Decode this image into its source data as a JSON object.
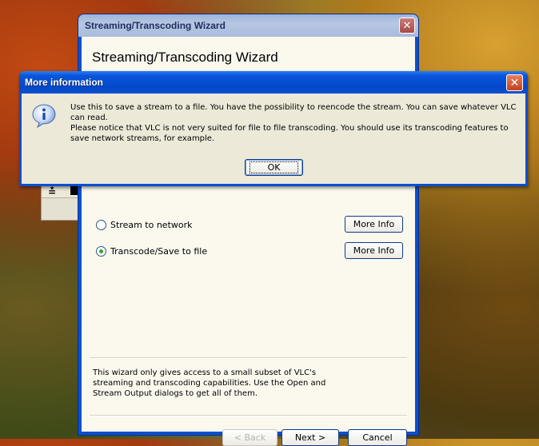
{
  "wizard": {
    "title": "Streaming/Transcoding Wizard",
    "heading": "Streaming/Transcoding Wizard",
    "close_glyph": "✕",
    "options": [
      {
        "label": "Stream to network",
        "selected": false,
        "more_info": "More Info"
      },
      {
        "label": "Transcode/Save to file",
        "selected": true,
        "more_info": "More Info"
      }
    ],
    "note": "This wizard only gives access to a small subset of VLC's streaming and transcoding capabilities. Use the Open and Stream Output dialogs to get all of them.",
    "buttons": {
      "back": "< Back",
      "next": "Next >",
      "cancel": "Cancel"
    }
  },
  "background_window": {
    "glyph": "≛"
  },
  "dialog": {
    "title": "More information",
    "close_glyph": "✕",
    "icon": "info-icon",
    "text_line1": "Use this to save a stream to a file. You have the possibility to reencode the stream. You can save whatever VLC can read.",
    "text_line2": "Please notice that VLC is not very suited for file to file transcoding. You should use its transcoding features to save network streams, for example.",
    "ok": "OK"
  }
}
